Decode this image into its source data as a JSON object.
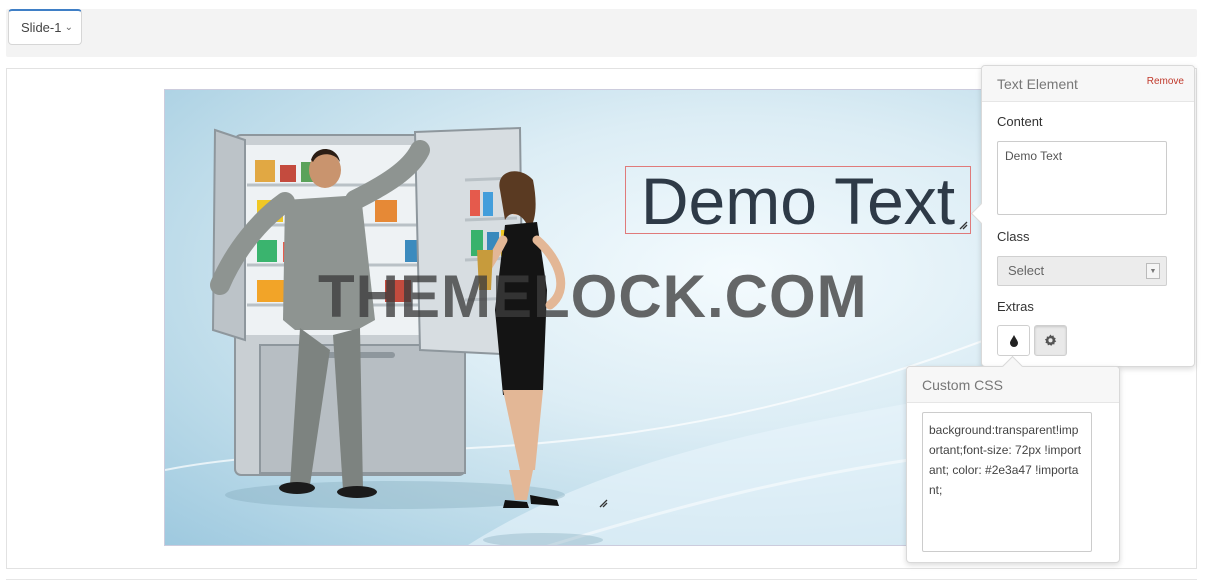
{
  "toolbar": {
    "slide_select_value": "Slide-1"
  },
  "slide": {
    "text_element_value": "Demo Text",
    "watermark": "THEMELOCK.COM"
  },
  "text_element_panel": {
    "title": "Text Element",
    "remove_label": "Remove",
    "content_label": "Content",
    "content_value": "Demo Text",
    "class_label": "Class",
    "class_value": "Select",
    "extras_label": "Extras",
    "extras_buttons": [
      "drop-icon",
      "gear-icon"
    ]
  },
  "custom_css_panel": {
    "title": "Custom CSS",
    "value": "background:transparent!important;font-size: 72px !important; color: #2e3a47 !important;"
  },
  "colors": {
    "text_color": "#2e3a47",
    "remove_color": "#c0392b",
    "accent": "#3f7fc6"
  }
}
